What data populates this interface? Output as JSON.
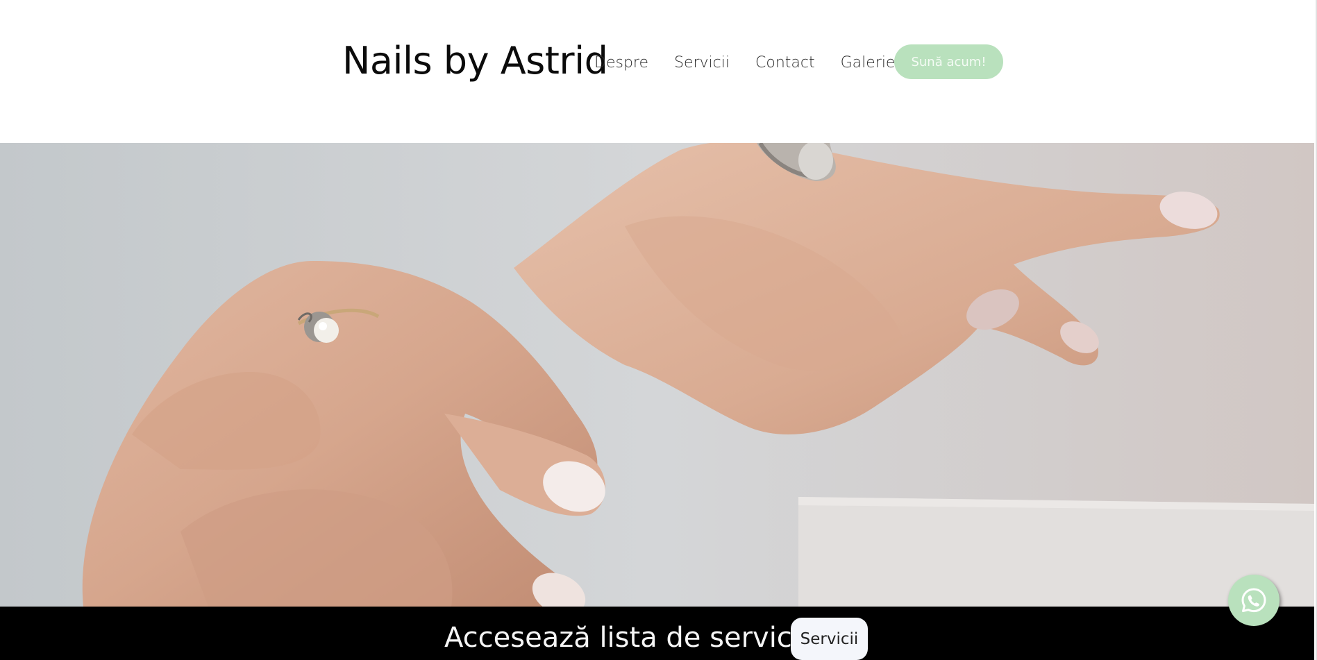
{
  "header": {
    "brand": "Nails by Astrid",
    "nav": [
      "Despre",
      "Servicii",
      "Contact",
      "Galerie"
    ],
    "cta_label": "Sună acum!"
  },
  "hero": {
    "image": "hands-with-rings-manicure-photo"
  },
  "banner": {
    "text": "Accesează lista de servicii !",
    "button_label": "Servicii"
  },
  "floating": {
    "icon": "whatsapp-icon"
  },
  "colors": {
    "accent": "#b9e1bd",
    "banner_bg": "#000000",
    "header_bg": "#ffffff"
  }
}
